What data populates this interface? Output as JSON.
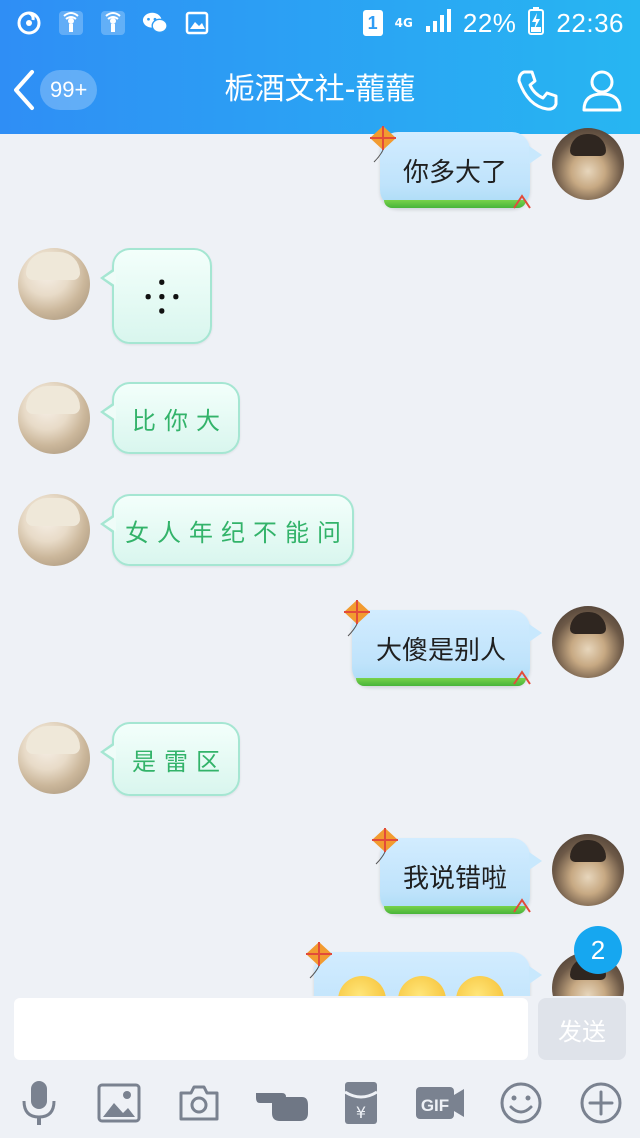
{
  "status_bar": {
    "sim_number": "1",
    "network_type": "4G",
    "battery_percent": "22%",
    "time": "22:36",
    "icons": [
      "netease-music-icon",
      "qq-hotspot-icon",
      "qq-hotspot-icon",
      "wechat-icon",
      "gallery-icon",
      "signal-icon",
      "battery-charging-icon"
    ]
  },
  "header": {
    "unread_count": "99+",
    "title": "栀酒文社-蘢蘢",
    "icons": [
      "back-chevron-icon",
      "phone-icon",
      "profile-icon"
    ]
  },
  "messages": [
    {
      "side": "right",
      "text": "你多大了",
      "style": "kite-bubble"
    },
    {
      "side": "left",
      "icon": "anger-vein-icon",
      "glyph": "⸭",
      "style": "mint-bubble"
    },
    {
      "side": "left",
      "text": "比你大",
      "style": "mint-bubble"
    },
    {
      "side": "left",
      "text": "女人年纪不能问",
      "style": "mint-bubble"
    },
    {
      "side": "right",
      "text": "大傻是别人",
      "style": "kite-bubble"
    },
    {
      "side": "left",
      "text": "是雷区",
      "style": "mint-bubble"
    },
    {
      "side": "right",
      "text": "我说错啦",
      "style": "kite-bubble"
    },
    {
      "side": "right",
      "emojis": [
        "pensive-face",
        "pensive-face",
        "pensive-face"
      ],
      "style": "kite-bubble",
      "partially_visible": true
    }
  ],
  "new_message_badge": "2",
  "input": {
    "value": "",
    "placeholder": "",
    "send_label": "发送"
  },
  "toolbar": {
    "gif_label": "GIF",
    "items": [
      "microphone-icon",
      "image-icon",
      "camera-icon",
      "poke-hand-icon",
      "red-packet-icon",
      "gif-icon",
      "emoji-icon",
      "plus-icon"
    ]
  },
  "colors": {
    "header_gradient_start": "#2f8ef5",
    "header_gradient_end": "#27b6f2",
    "chat_background": "#eef1f6",
    "left_bubble_text": "#33b36a",
    "right_bubble": "#c8e8fd",
    "badge_blue": "#16a7f0"
  }
}
